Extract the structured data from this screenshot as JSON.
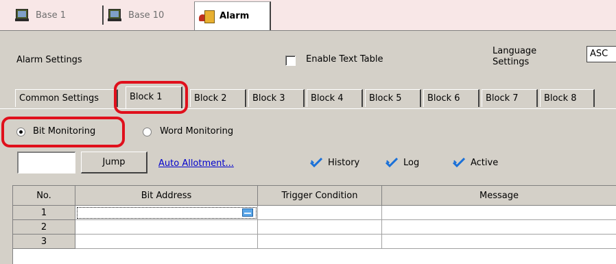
{
  "doc_tabs": [
    {
      "label": "Base 1",
      "icon": "monitor-icon"
    },
    {
      "label": "Base 10",
      "icon": "monitor-icon"
    },
    {
      "label": "Alarm",
      "icon": "alarm-icon",
      "active": true
    }
  ],
  "settings": {
    "title": "Alarm Settings",
    "enable_text_table_label": "Enable Text Table",
    "enable_text_table_checked": false,
    "language_label_line1": "Language",
    "language_label_line2": "Settings",
    "language_value": "ASC"
  },
  "block_tabs": [
    {
      "label": "Common Settings"
    },
    {
      "label": "Block 1",
      "active": true
    },
    {
      "label": "Block 2"
    },
    {
      "label": "Block 3"
    },
    {
      "label": "Block 4"
    },
    {
      "label": "Block 5"
    },
    {
      "label": "Block 6"
    },
    {
      "label": "Block 7"
    },
    {
      "label": "Block 8"
    }
  ],
  "monitoring": {
    "bit_label": "Bit Monitoring",
    "word_label": "Word Monitoring",
    "selected": "bit"
  },
  "jump": {
    "input_value": "",
    "button_label": "Jump",
    "auto_allotment_link": "Auto Allotment..."
  },
  "options": {
    "history_label": "History",
    "log_label": "Log",
    "active_label": "Active"
  },
  "table": {
    "headers": [
      "No.",
      "Bit Address",
      "Trigger Condition",
      "Message"
    ],
    "rows": [
      {
        "no": "1",
        "bit_address": "",
        "trigger": "",
        "message": ""
      },
      {
        "no": "2",
        "bit_address": "",
        "trigger": "",
        "message": ""
      },
      {
        "no": "3",
        "bit_address": "",
        "trigger": "",
        "message": ""
      }
    ]
  },
  "colors": {
    "highlight": "#e0101c",
    "link": "#0000cc",
    "checkmark": "#1a70d8",
    "doc_tab_bar": "#f8e7e7",
    "dialog_bg": "#d4d0c8"
  }
}
